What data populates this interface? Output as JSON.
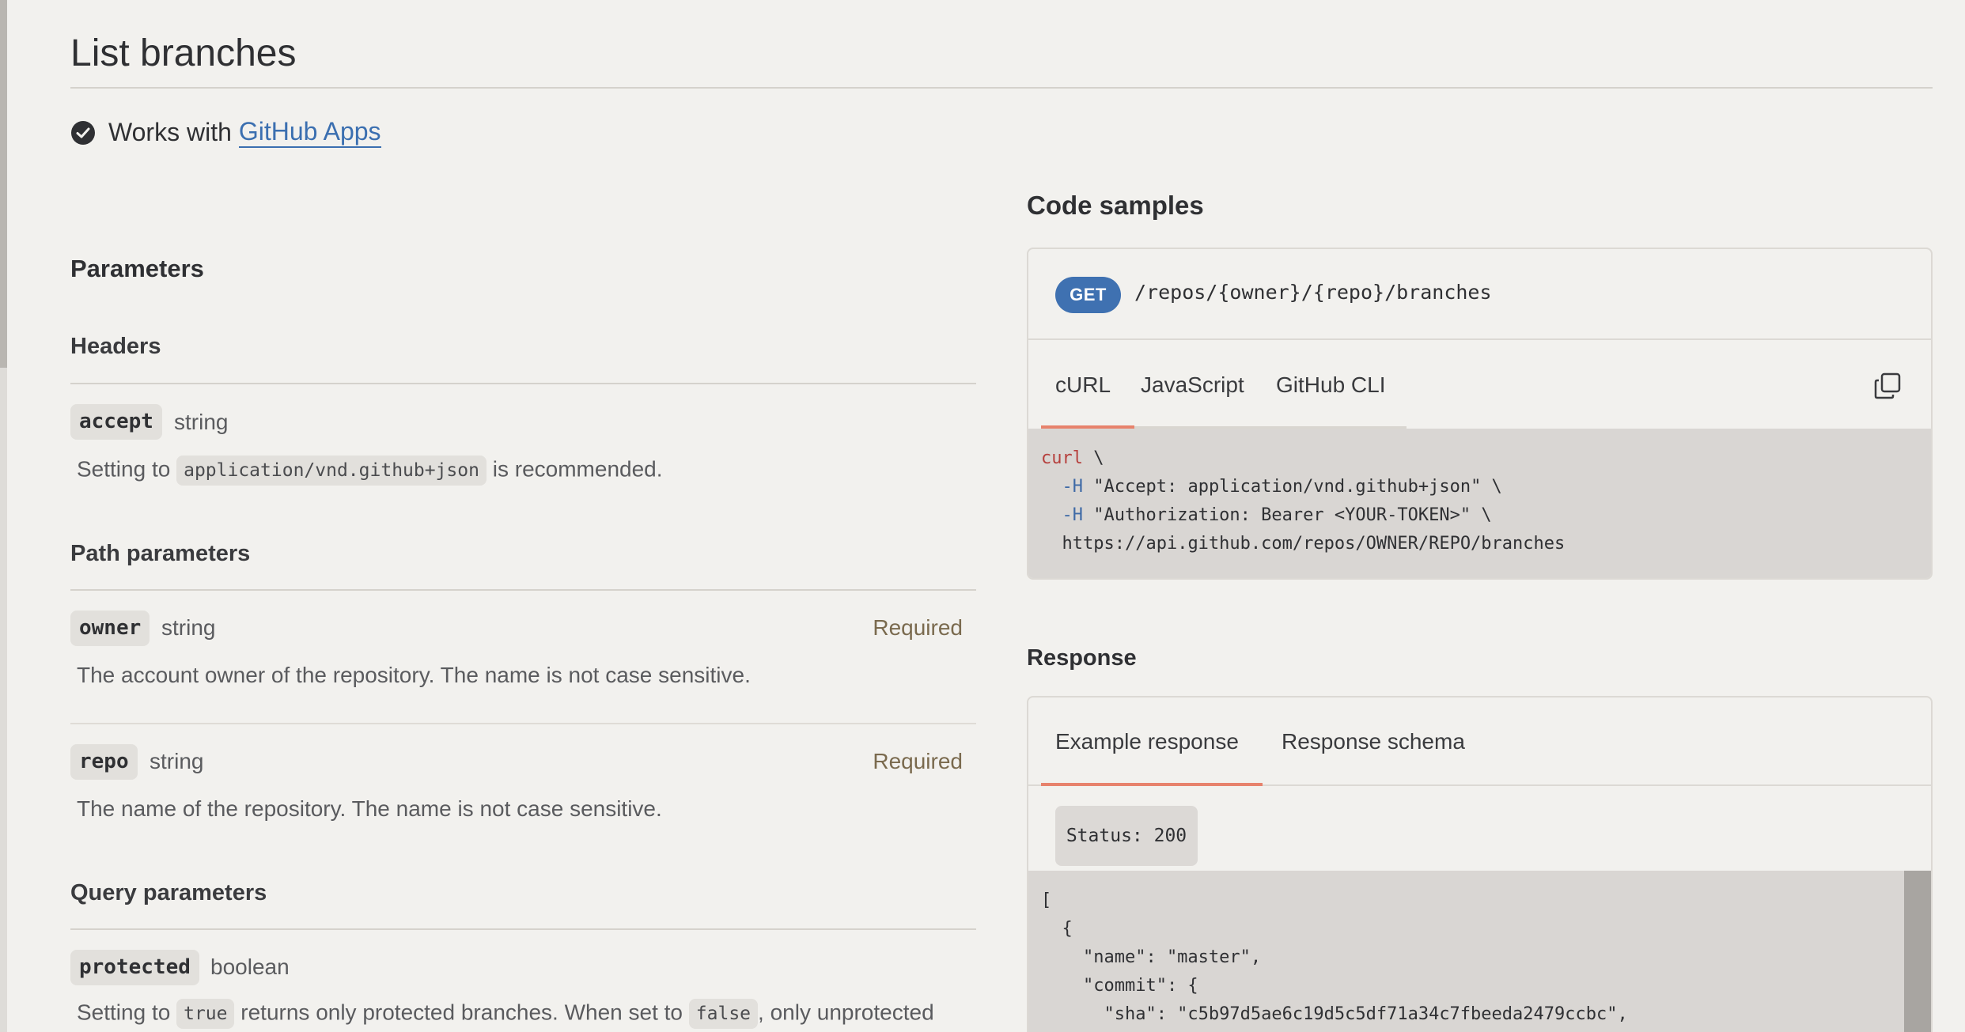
{
  "page": {
    "title": "List branches",
    "works_with_text": "Works with",
    "works_with_link": "GitHub Apps"
  },
  "parameters": {
    "heading": "Parameters",
    "headers": {
      "heading": "Headers",
      "items": [
        {
          "name": "accept",
          "type": "string",
          "desc_prefix": "Setting to",
          "desc_code": "application/vnd.github+json",
          "desc_suffix": "is recommended."
        }
      ]
    },
    "path": {
      "heading": "Path parameters",
      "items": [
        {
          "name": "owner",
          "type": "string",
          "required": "Required",
          "desc": "The account owner of the repository. The name is not case sensitive."
        },
        {
          "name": "repo",
          "type": "string",
          "required": "Required",
          "desc": "The name of the repository. The name is not case sensitive."
        }
      ]
    },
    "query": {
      "heading": "Query parameters",
      "items": [
        {
          "name": "protected",
          "type": "boolean",
          "desc_prefix": "Setting to",
          "desc_code1": "true",
          "desc_mid": "returns only protected branches. When set to",
          "desc_code2": "false",
          "desc_suffix": ", only unprotected"
        }
      ]
    }
  },
  "code_samples": {
    "heading": "Code samples",
    "method": "GET",
    "path": "/repos/{owner}/{repo}/branches",
    "tabs": [
      "cURL",
      "JavaScript",
      "GitHub CLI"
    ],
    "active_tab": "cURL",
    "code_lines": [
      {
        "cmd": "curl",
        "rest": " \\"
      },
      {
        "flag": "-H",
        "rest": " \"Accept: application/vnd.github+json\" \\"
      },
      {
        "flag": "-H",
        "rest": " \"Authorization: Bearer <YOUR-TOKEN>\" \\"
      },
      {
        "rest": "https://api.github.com/repos/OWNER/REPO/branches"
      }
    ]
  },
  "response": {
    "heading": "Response",
    "tabs": [
      "Example response",
      "Response schema"
    ],
    "active_tab": "Example response",
    "status": "Status: 200",
    "json_lines": [
      "[",
      "  {",
      "    \"name\": \"master\",",
      "    \"commit\": {",
      "      \"sha\": \"c5b97d5ae6c19d5c5df71a34c7fbeeda2479ccbc\","
    ]
  }
}
